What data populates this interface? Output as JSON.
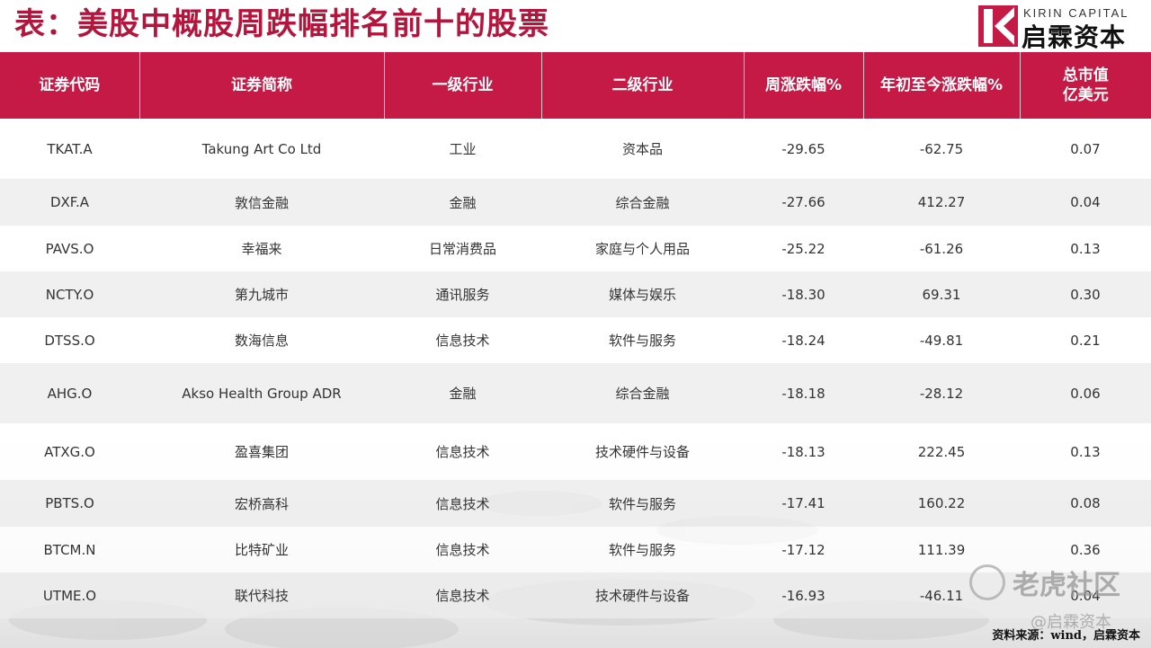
{
  "title": "表：美股中概股周跌幅排名前十的股票",
  "logo": {
    "en": "KIRIN CAPITAL",
    "cn": "启霖资本"
  },
  "colors": {
    "header_bg": "#c41a45",
    "title": "#b3163d"
  },
  "table": {
    "headers": [
      "证券代码",
      "证券简称",
      "一级行业",
      "二级行业",
      "周涨跌幅%",
      "年初至今涨跌幅%",
      "总市值\n亿美元"
    ],
    "rows": [
      [
        "TKAT.A",
        "Takung Art Co Ltd",
        "工业",
        "资本品",
        "-29.65",
        "-62.75",
        "0.07"
      ],
      [
        "DXF.A",
        "敦信金融",
        "金融",
        "综合金融",
        "-27.66",
        "412.27",
        "0.04"
      ],
      [
        "PAVS.O",
        "幸福来",
        "日常消费品",
        "家庭与个人用品",
        "-25.22",
        "-61.26",
        "0.13"
      ],
      [
        "NCTY.O",
        "第九城市",
        "通讯服务",
        "媒体与娱乐",
        "-18.30",
        "69.31",
        "0.30"
      ],
      [
        "DTSS.O",
        "数海信息",
        "信息技术",
        "软件与服务",
        "-18.24",
        "-49.81",
        "0.21"
      ],
      [
        "AHG.O",
        "Akso Health Group ADR",
        "金融",
        "综合金融",
        "-18.18",
        "-28.12",
        "0.06"
      ],
      [
        "ATXG.O",
        "盈喜集团",
        "信息技术",
        "技术硬件与设备",
        "-18.13",
        "222.45",
        "0.13"
      ],
      [
        "PBTS.O",
        "宏桥高科",
        "信息技术",
        "软件与服务",
        "-17.41",
        "160.22",
        "0.08"
      ],
      [
        "BTCM.N",
        "比特矿业",
        "信息技术",
        "软件与服务",
        "-17.12",
        "111.39",
        "0.36"
      ],
      [
        "UTME.O",
        "联代科技",
        "信息技术",
        "技术硬件与设备",
        "-16.93",
        "-46.11",
        "0.04"
      ]
    ]
  },
  "watermark": {
    "main": "老虎社区",
    "sub": "@启霖资本"
  },
  "source": "资料来源：wind，启霖资本"
}
